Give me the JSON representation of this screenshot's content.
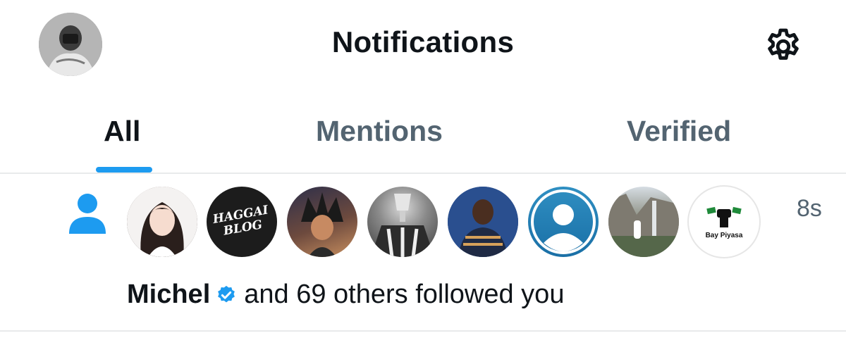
{
  "header": {
    "title": "Notifications",
    "avatar_icon": "profile-avatar",
    "settings_icon": "gear-icon"
  },
  "tabs": [
    {
      "label": "All",
      "active": true
    },
    {
      "label": "Mentions",
      "active": false
    },
    {
      "label": "Verified",
      "active": false
    }
  ],
  "notification": {
    "type_icon": "person-icon",
    "time": "8s",
    "name": "Michel",
    "verified_icon": "verified-badge-icon",
    "text": "and 69 others followed you",
    "avatars": [
      {
        "label": ""
      },
      {
        "label": "HAGGAI BLOG"
      },
      {
        "label": ""
      },
      {
        "label": ""
      },
      {
        "label": ""
      },
      {
        "label": ""
      },
      {
        "label": ""
      },
      {
        "label": "Bay Piyasa"
      }
    ]
  },
  "colors": {
    "accent": "#1d9bf0",
    "text_primary": "#0f1419",
    "text_secondary": "#536471",
    "divider": "#e8eaeb"
  }
}
